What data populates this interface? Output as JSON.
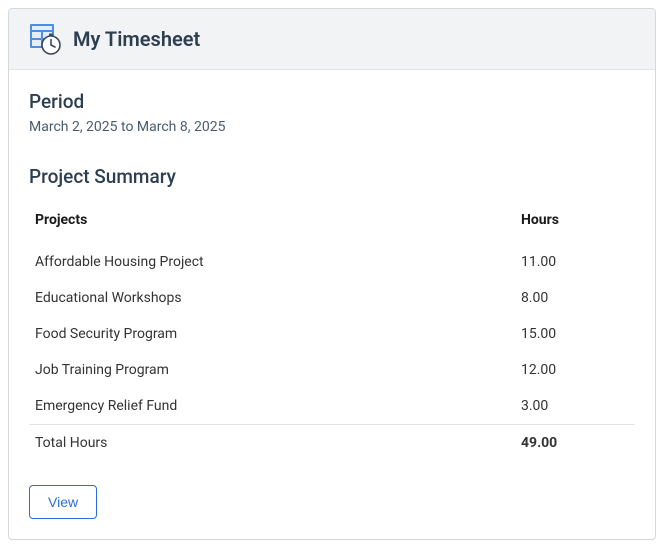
{
  "header": {
    "title": "My Timesheet",
    "icon_name": "timesheet-clock-icon"
  },
  "period": {
    "label": "Period",
    "value": "March 2, 2025 to March 8, 2025"
  },
  "summary": {
    "title": "Project Summary",
    "columns": {
      "projects": "Projects",
      "hours": "Hours"
    },
    "rows": [
      {
        "project": "Affordable Housing Project",
        "hours": "11.00"
      },
      {
        "project": "Educational Workshops",
        "hours": "8.00"
      },
      {
        "project": "Food Security Program",
        "hours": "15.00"
      },
      {
        "project": "Job Training Program",
        "hours": "12.00"
      },
      {
        "project": "Emergency Relief Fund",
        "hours": "3.00"
      }
    ],
    "total": {
      "label": "Total Hours",
      "hours": "49.00"
    }
  },
  "actions": {
    "view_label": "View"
  }
}
